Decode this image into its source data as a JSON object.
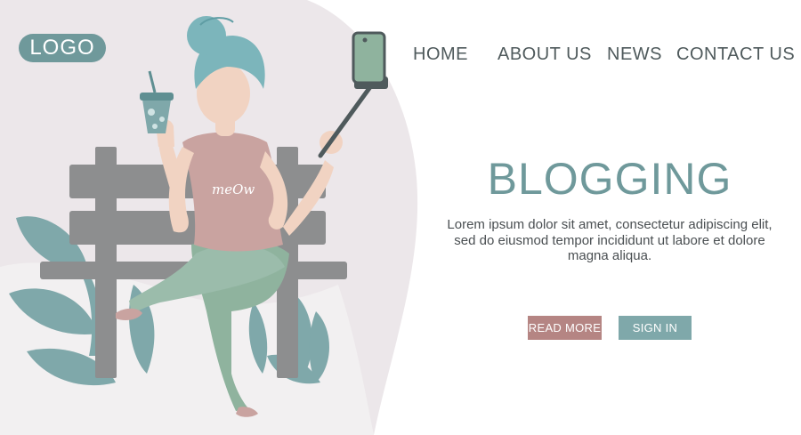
{
  "header": {
    "logo": "LOGO",
    "nav": [
      "HOME",
      "ABOUT US",
      "NEWS",
      "CONTACT US"
    ]
  },
  "hero": {
    "title": "BLOGGING",
    "text": "Lorem ipsum dolor sit amet, consectetur adipiscing elit, sed do eiusmod tempor incididunt ut labore et dolore magna aliqua.",
    "read_more_label": "READ MORE",
    "sign_in_label": "SIGN IN"
  },
  "illustration": {
    "shirt_text": "meOw"
  },
  "colors": {
    "teal": "#6f999b",
    "teal_light": "#7fa8aa",
    "rose": "#b58583",
    "shirt": "#c9a3a0",
    "pants": "#8fb39e",
    "hair": "#7cb5bb",
    "skin": "#f1d3c2",
    "bench": "#8d8e8f",
    "backdrop": "#ece7ea"
  }
}
